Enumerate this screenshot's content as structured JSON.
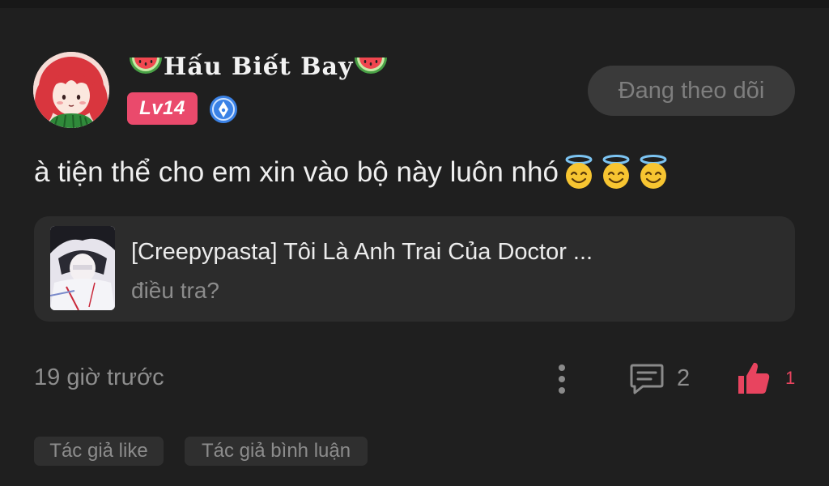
{
  "user": {
    "name": "Hấu Biết Bay",
    "level": "Lv14",
    "follow_label": "Đang theo dõi"
  },
  "comment": {
    "text": "à tiện thể cho em xin vào bộ này luôn nhó"
  },
  "story": {
    "title": "[Creepypasta] Tôi Là Anh Trai Của Doctor ...",
    "subtitle": "điều tra?"
  },
  "footer": {
    "timestamp": "19 giờ trước",
    "comment_count": "2",
    "like_count": "1"
  },
  "tags": [
    "Tác giả like",
    "Tác giả bình luận"
  ],
  "icons": {
    "name_prefix": "watermelon-icon",
    "name_suffix": "watermelon-icon",
    "author_badge": "pen-badge-icon",
    "emoji": "smiling-face-with-halo",
    "more": "more-vertical-icon",
    "comment": "comment-icon",
    "like": "thumbs-up-icon"
  },
  "colors": {
    "background": "#1f1f1f",
    "card": "#2c2c2c",
    "level_badge": "#ea4a6c",
    "like": "#e8445f",
    "author_badge": "#3b82e6"
  }
}
